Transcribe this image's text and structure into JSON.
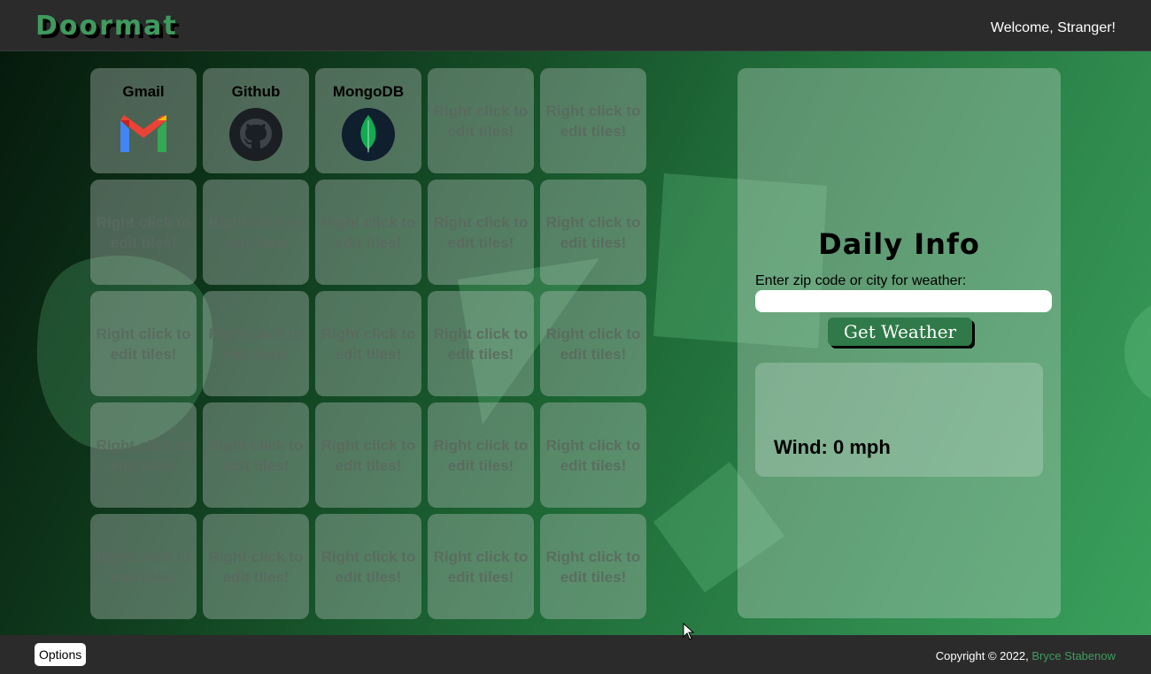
{
  "header": {
    "logo": "Doormat",
    "welcome": "Welcome, Stranger!"
  },
  "tiles": [
    {
      "name": "Gmail",
      "icon": "gmail-icon"
    },
    {
      "name": "Github",
      "icon": "github-icon"
    },
    {
      "name": "MongoDB",
      "icon": "mongodb-icon"
    }
  ],
  "empty_tile_text": "Right click to edit tiles!",
  "daily_info": {
    "title": "Daily Info",
    "zip_label": "Enter zip code or city for weather:",
    "zip_value": "",
    "button_label": "Get Weather",
    "wind": "Wind: 0 mph"
  },
  "footer": {
    "options_label": "Options",
    "copyright": "Copyright © 2022, ",
    "author": "Bryce Stabenow"
  },
  "colors": {
    "brand_green": "#3f9a5e",
    "header_bg": "#2b2b2b",
    "button_green": "#2f7a48"
  }
}
